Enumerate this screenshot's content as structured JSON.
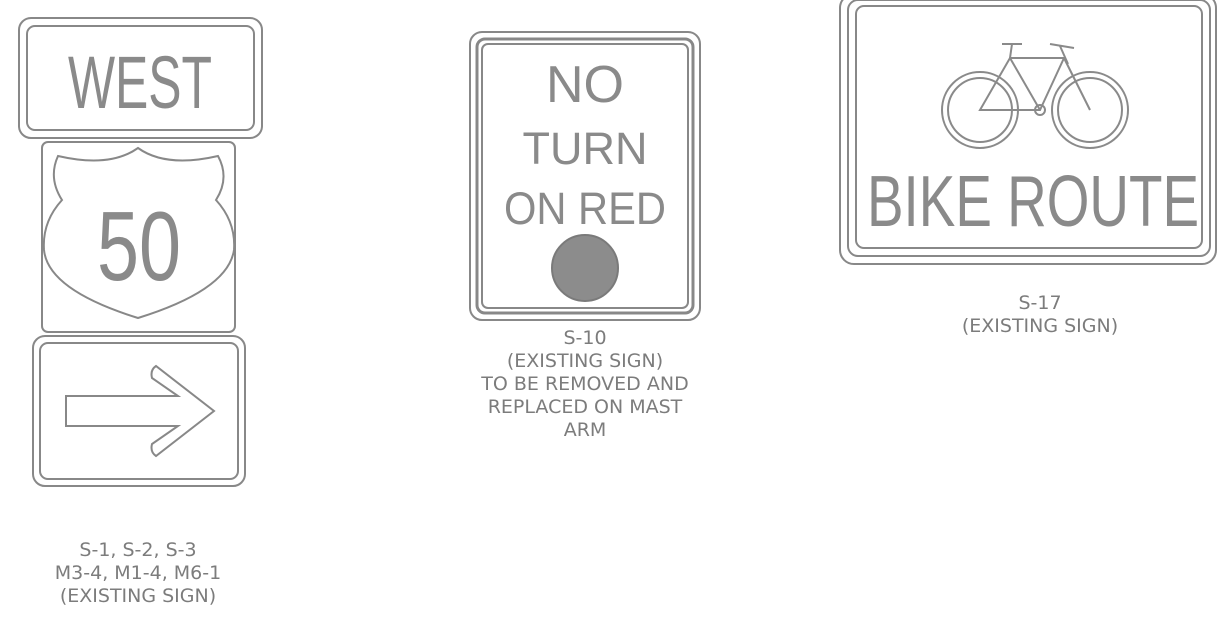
{
  "signs": {
    "west_tab": {
      "text": "WEST"
    },
    "us_route": {
      "number": "50"
    },
    "arrow_tab": {
      "icon": "right-arrow-icon"
    },
    "no_turn_on_red": {
      "line1": "NO",
      "line2": "TURN",
      "line3": "ON RED",
      "symbol": "red-ball-icon"
    },
    "bike_route": {
      "text": "BIKE ROUTE",
      "icon": "bicycle-icon"
    }
  },
  "captions": {
    "left": {
      "line1": "S-1, S-2, S-3",
      "line2": "M3-4, M1-4, M6-1",
      "line3": "(EXISTING SIGN)"
    },
    "middle": {
      "line1": "S-10",
      "line2": "(EXISTING SIGN)",
      "line3": "TO BE REMOVED AND",
      "line4": "REPLACED ON MAST",
      "line5": "ARM"
    },
    "right": {
      "line1": "S-17",
      "line2": "(EXISTING SIGN)"
    }
  }
}
